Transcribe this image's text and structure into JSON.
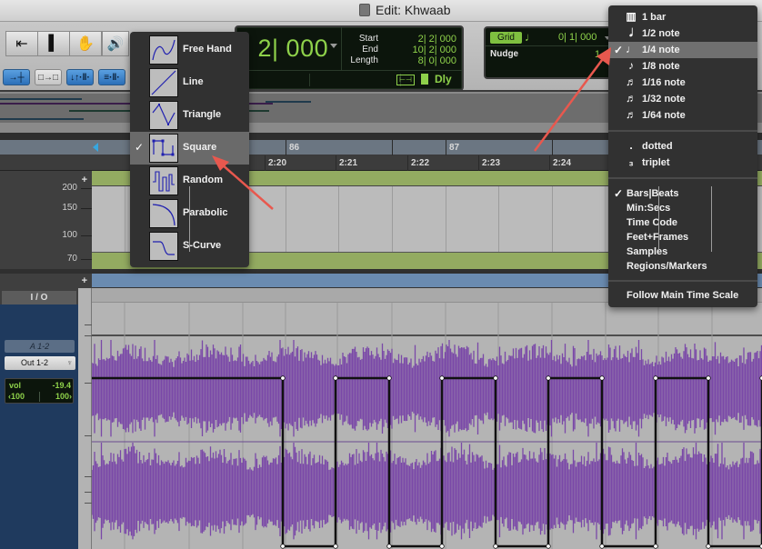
{
  "window": {
    "title": "Edit: Khwaab"
  },
  "toolbar": {
    "tools": [
      {
        "name": "zoomer-tool",
        "glyph": "⇤"
      },
      {
        "name": "trim-tool",
        "glyph": "▌"
      },
      {
        "name": "grabber-tool",
        "glyph": "✋"
      }
    ],
    "speaker_glyph": "🔊",
    "edit_modes": [
      {
        "name": "shuffle-mode",
        "glyph": "→┼",
        "active": true
      },
      {
        "name": "slip-mode",
        "glyph": "□→□",
        "active": false
      },
      {
        "name": "spot-mode",
        "glyph": "↓↑·‖·",
        "active": true
      },
      {
        "name": "grid-mode",
        "glyph": "≡·‖·",
        "active": true
      }
    ]
  },
  "counter": {
    "main": "| 2| 000",
    "selection": {
      "labels": [
        "Start",
        "End",
        "Length"
      ],
      "values": [
        "2| 2| 000",
        "10| 2| 000",
        "8| 0| 000"
      ]
    },
    "dly_label": "Dly"
  },
  "grid": {
    "tag": "Grid",
    "note_glyph": "♩",
    "value": "0| 1| 000",
    "nudge_label": "Nudge",
    "nudge_value": "1"
  },
  "rulers": {
    "bars": [
      {
        "label": "86"
      },
      {
        "label": "87"
      }
    ],
    "min_secs": [
      "2:20",
      "2:21",
      "2:22",
      "2:23",
      "2:24"
    ]
  },
  "tempo_lane": {
    "axis_labels": [
      "200",
      "150",
      "100",
      "70"
    ]
  },
  "track": {
    "io_header": "I / O",
    "input": "A 1-2",
    "output": "Out 1-2",
    "vol_label": "vol",
    "vol_value": "-19.4",
    "pan_left": "‹100",
    "pan_right": "100›"
  },
  "shape_menu": {
    "items": [
      {
        "label": "Free Hand",
        "selected": false
      },
      {
        "label": "Line",
        "selected": false
      },
      {
        "label": "Triangle",
        "selected": false
      },
      {
        "label": "Square",
        "selected": true
      },
      {
        "label": "Random",
        "selected": false
      },
      {
        "label": "Parabolic",
        "selected": false
      },
      {
        "label": "S-Curve",
        "selected": false
      }
    ],
    "check_glyph": "✓"
  },
  "grid_menu": {
    "note_values": [
      {
        "label": "1 bar",
        "icon": "bar-icon",
        "glyph": "▥",
        "selected": false
      },
      {
        "label": "1/2 note",
        "icon": "half-note-icon",
        "glyph": "𝅗𝅥",
        "selected": false
      },
      {
        "label": "1/4 note",
        "icon": "quarter-note-icon",
        "glyph": "♩",
        "selected": true
      },
      {
        "label": "1/8 note",
        "icon": "eighth-note-icon",
        "glyph": "♪",
        "selected": false
      },
      {
        "label": "1/16 note",
        "icon": "sixteenth-note-icon",
        "glyph": "♬",
        "selected": false
      },
      {
        "label": "1/32 note",
        "icon": "thirty-second-note-icon",
        "glyph": "♬",
        "selected": false
      },
      {
        "label": "1/64 note",
        "icon": "sixty-fourth-note-icon",
        "glyph": "♬",
        "selected": false
      }
    ],
    "modifiers": [
      {
        "label": "dotted",
        "glyph": ".",
        "selected": false
      },
      {
        "label": "triplet",
        "glyph": "₃",
        "selected": false
      }
    ],
    "time_scales": [
      {
        "label": "Bars|Beats",
        "selected": true
      },
      {
        "label": "Min:Secs",
        "selected": false
      },
      {
        "label": "Time Code",
        "selected": false
      },
      {
        "label": "Feet+Frames",
        "selected": false
      },
      {
        "label": "Samples",
        "selected": false
      },
      {
        "label": "Regions/Markers",
        "selected": false
      }
    ],
    "follow": {
      "label": "Follow Main Time Scale"
    },
    "check_glyph": "✓"
  },
  "colors": {
    "counter_green": "#8ed14a",
    "waveform": "#7a48a8",
    "tempo_lane": "#93ab61",
    "marker_lane": "#6a8bb0",
    "track_panel": "#1f3a5e",
    "annotation_arrow": "#e8584e"
  }
}
